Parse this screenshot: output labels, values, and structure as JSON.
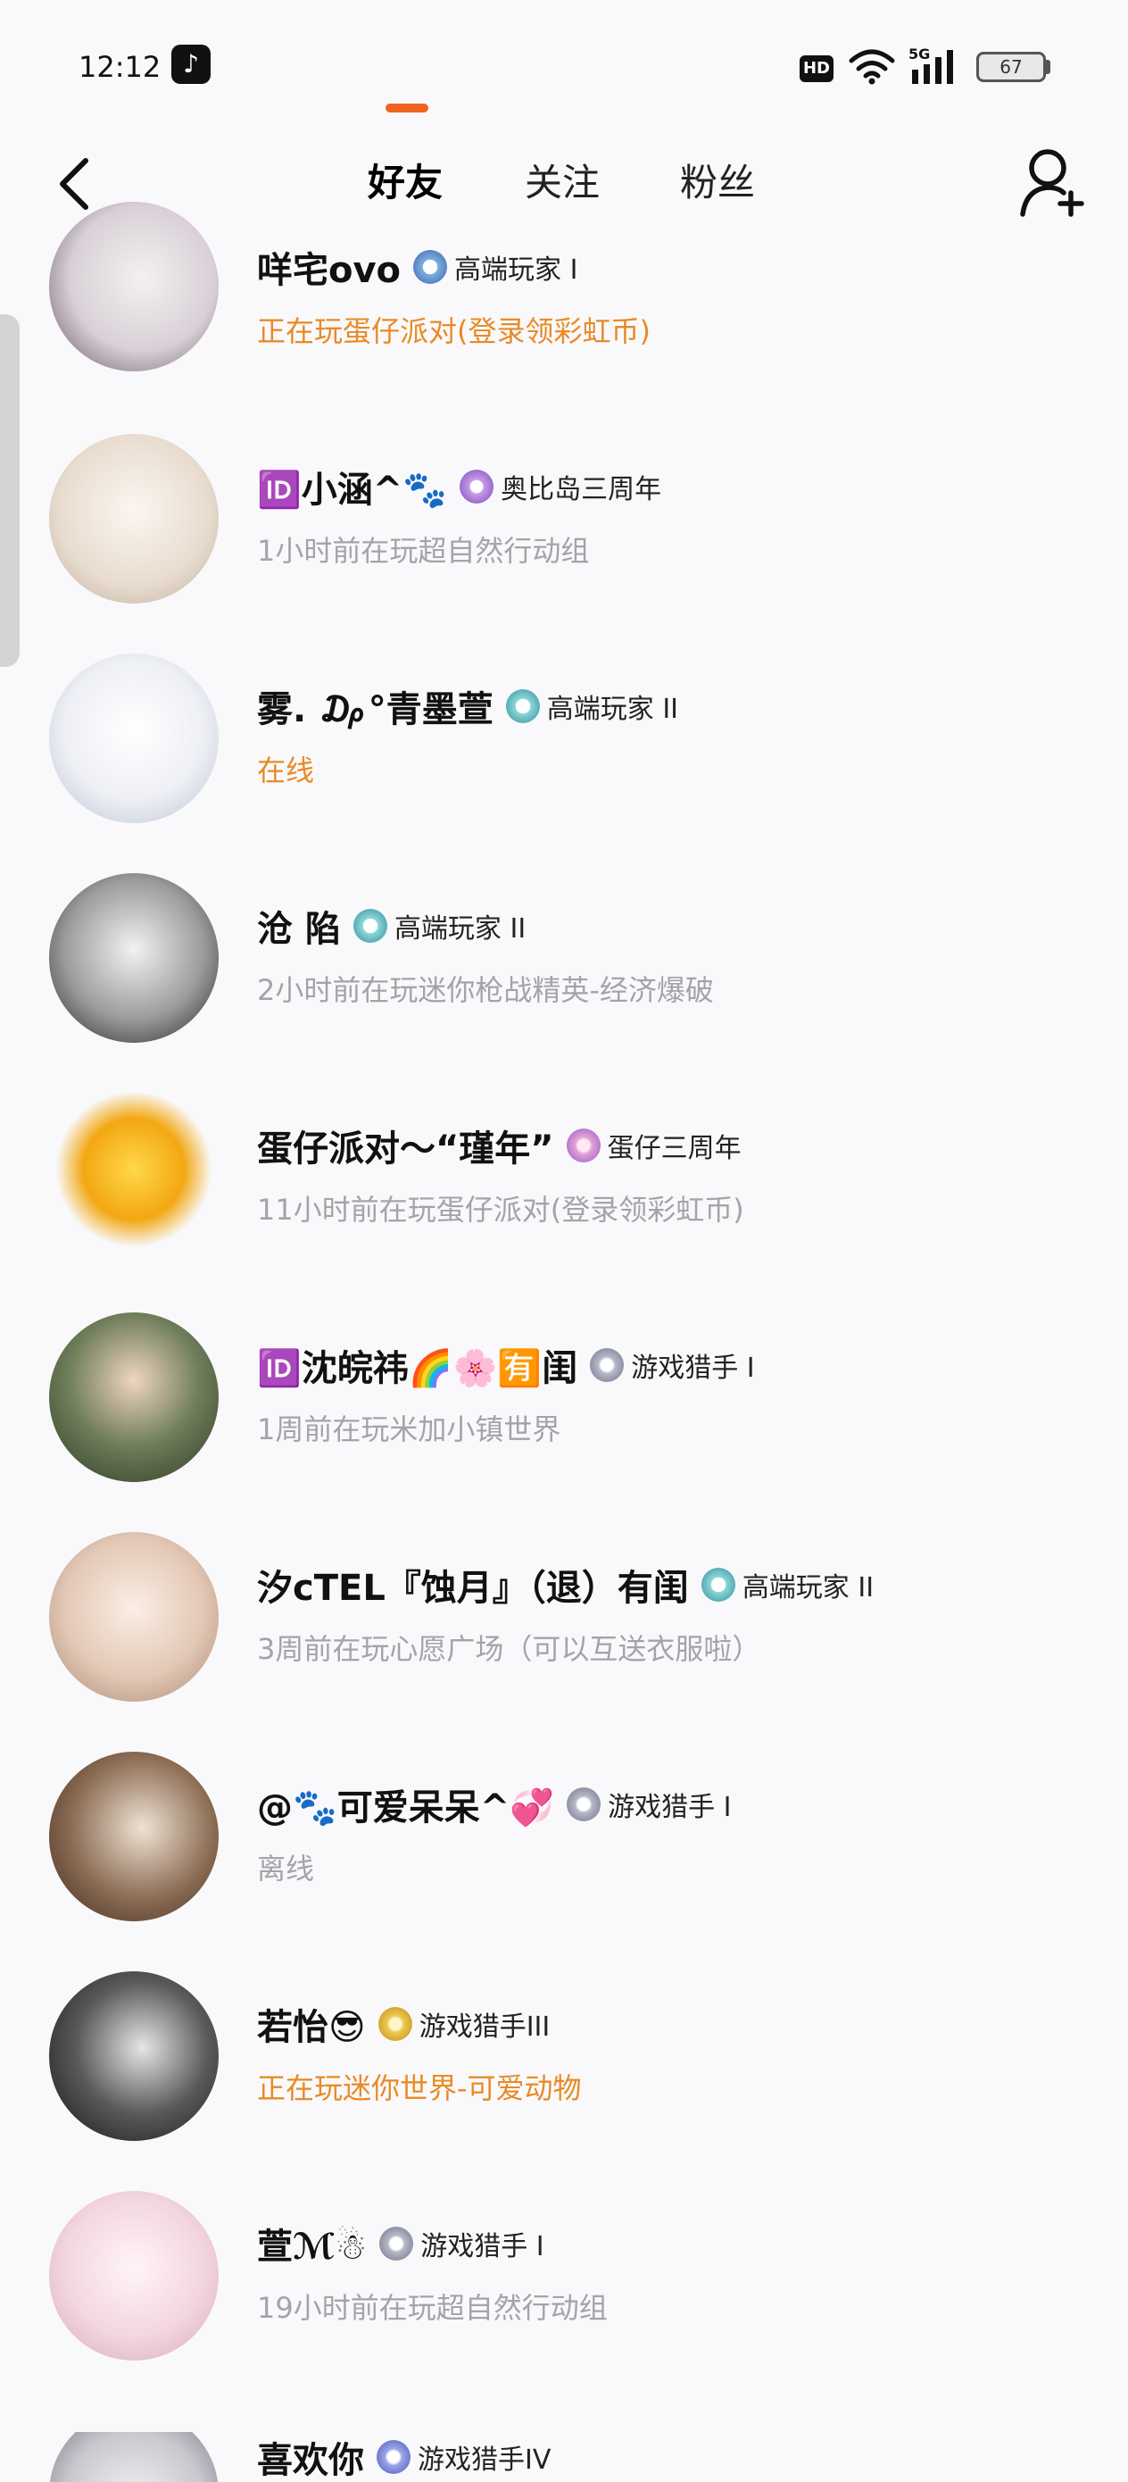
{
  "status_bar": {
    "time": "12:12",
    "tiktok_icon": "tiktok-icon",
    "hd_label": "HD",
    "network_label": "5G",
    "battery_level": "67"
  },
  "header": {
    "back_icon": "back-arrow-icon",
    "tabs": [
      {
        "label": "好友",
        "active": true
      },
      {
        "label": "关注",
        "active": false
      },
      {
        "label": "粉丝",
        "active": false
      }
    ],
    "add_friend_icon": "add-user-icon"
  },
  "colors": {
    "accent": "#f0621e",
    "online_status": "#e98a25",
    "offline_status": "#a4a4a8"
  },
  "friends": [
    {
      "name": "咩宅ovo",
      "badge": "高端玩家 I",
      "status": "正在玩蛋仔派对(登录领彩虹币)",
      "online": true
    },
    {
      "name": "🆔小涵^🐾",
      "badge": "奥比岛三周年",
      "status": "1小时前在玩超自然行动组",
      "online": false
    },
    {
      "name": "雾. ₯°青墨萱",
      "badge": "高端玩家 II",
      "status": "在线",
      "online": true
    },
    {
      "name": "沧     陷",
      "badge": "高端玩家 II",
      "status": "2小时前在玩迷你枪战精英-经济爆破",
      "online": false
    },
    {
      "name": "蛋仔派对～“瑾年”",
      "badge": "蛋仔三周年",
      "status": "11小时前在玩蛋仔派对(登录领彩虹币)",
      "online": false
    },
    {
      "name": "🆔沈皖祎🌈🌸🈶闺",
      "badge": "游戏猎手 I",
      "status": "1周前在玩米加小镇世界",
      "online": false
    },
    {
      "name": "汐cTEL『蚀月』（退）有闺",
      "badge": "高端玩家 II",
      "status": "3周前在玩心愿广场（可以互送衣服啦）",
      "online": false
    },
    {
      "name": "@🐾可爱呆呆^💞",
      "badge": "游戏猎手 I",
      "status": "离线",
      "online": false
    },
    {
      "name": "若怡😎",
      "badge": "游戏猎手III",
      "status": "正在玩迷你世界-可爱动物",
      "online": true
    },
    {
      "name": "萱ℳ☃",
      "badge": "游戏猎手 I",
      "status": "19小时前在玩超自然行动组",
      "online": false
    },
    {
      "name": "喜欢你",
      "badge": "游戏猎手IV",
      "status": "",
      "online": false
    }
  ]
}
